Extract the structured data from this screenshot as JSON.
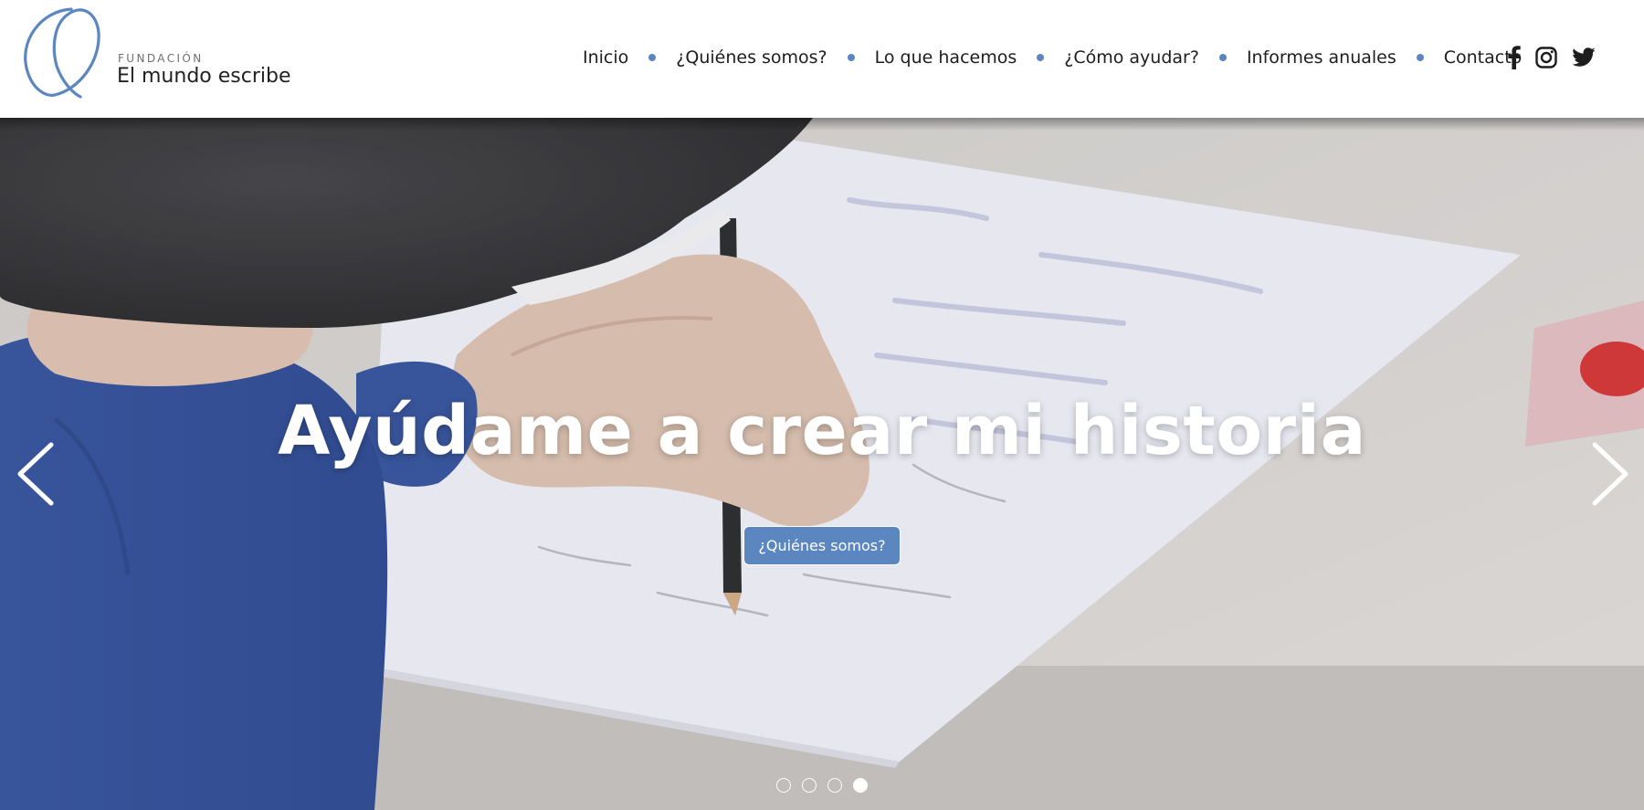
{
  "logo": {
    "small": "FUNDACIÓN",
    "name": "El mundo escribe"
  },
  "nav": {
    "items": [
      {
        "label": "Inicio"
      },
      {
        "label": "¿Quiénes somos?"
      },
      {
        "label": "Lo que hacemos"
      },
      {
        "label": "¿Cómo ayudar?"
      },
      {
        "label": "Informes anuales"
      },
      {
        "label": "Contacto"
      }
    ]
  },
  "social": {
    "icons": [
      "facebook-icon",
      "instagram-icon",
      "twitter-icon"
    ]
  },
  "hero": {
    "title": "Ayúdame a crear mi historia",
    "button_label": "¿Quiénes somos?",
    "slides_total": 4,
    "active_slide": 4
  },
  "colors": {
    "accent": "#5b86bf",
    "text": "#1d1d1d",
    "header_bg": "#ffffff"
  }
}
